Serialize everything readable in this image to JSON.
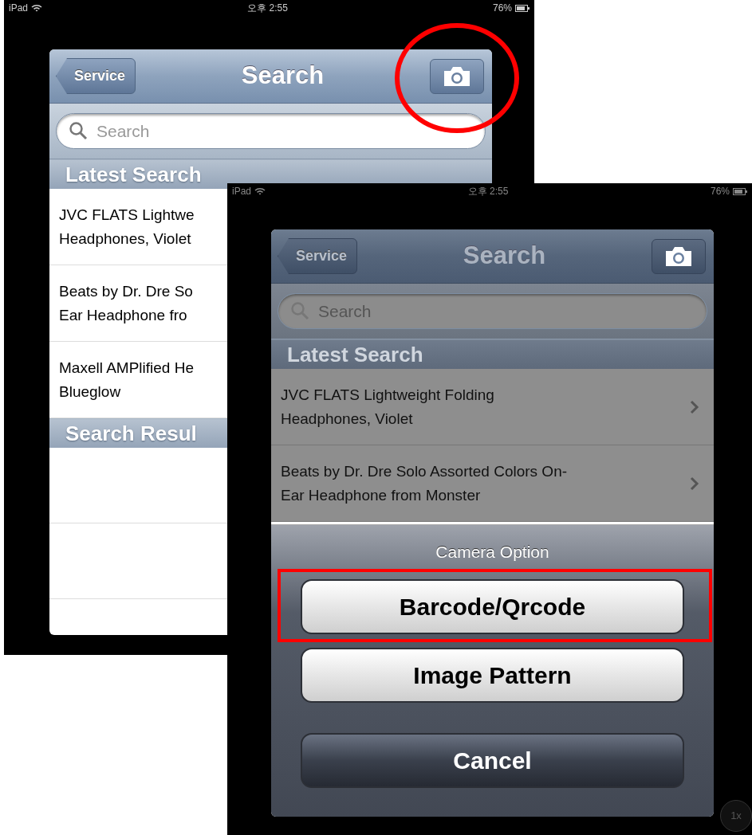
{
  "screens": [
    {
      "status_bar": {
        "device": "iPad",
        "time": "오후 2:55",
        "battery": "76%"
      },
      "dimmed": false,
      "nav": {
        "back": "Service",
        "title": "Search"
      },
      "search": {
        "placeholder": "Search"
      },
      "sections": [
        {
          "title": "Latest Search",
          "rows": [
            {
              "lines": [
                "JVC FLATS Lightwe",
                "Headphones, Violet"
              ]
            },
            {
              "lines": [
                "Beats by Dr. Dre So",
                "Ear Headphone fro"
              ]
            },
            {
              "lines": [
                "Maxell AMPlified He",
                "Blueglow"
              ]
            }
          ]
        },
        {
          "title": "Search Resul"
        }
      ]
    },
    {
      "status_bar": {
        "device": "iPad",
        "time": "오후 2:55",
        "battery": "76%"
      },
      "dimmed": true,
      "nav": {
        "back": "Service",
        "title": "Search"
      },
      "search": {
        "placeholder": "Search"
      },
      "sections": [
        {
          "title": "Latest Search",
          "rows": [
            {
              "lines": [
                "JVC FLATS Lightweight Folding",
                "Headphones, Violet"
              ],
              "disclosure": true
            },
            {
              "lines": [
                "Beats by Dr. Dre Solo Assorted Colors On-",
                "Ear Headphone from Monster"
              ],
              "disclosure": true
            }
          ]
        }
      ],
      "action_sheet": {
        "title": "Camera Option",
        "buttons": [
          {
            "label": "Barcode/Qrcode",
            "kind": "default"
          },
          {
            "label": "Image Pattern",
            "kind": "default"
          },
          {
            "label": "Cancel",
            "kind": "cancel"
          }
        ]
      }
    }
  ],
  "zoom_badge": "1x"
}
